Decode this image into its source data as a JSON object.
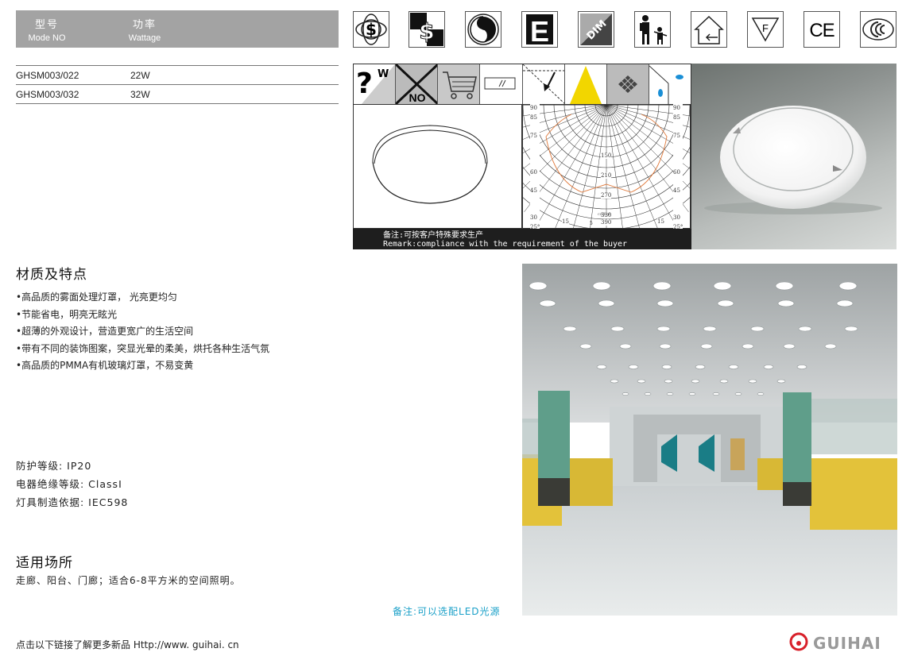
{
  "spec": {
    "header": {
      "model_cn": "型号",
      "model_en": "Mode NO",
      "watt_cn": "功率",
      "watt_en": "Wattage"
    },
    "rows": [
      {
        "model": "GHSM003/022",
        "watt": "22W"
      },
      {
        "model": "GHSM003/032",
        "watt": "32W"
      }
    ]
  },
  "cert_icons": [
    "energy-saving-icon",
    "cost-saving-icon",
    "recycle-icon",
    "e-mark-icon",
    "dim-icon",
    "child-safety-icon",
    "indoor-use-icon",
    "f-mark-icon",
    "ce-mark-icon",
    "ccc-mark-icon"
  ],
  "cert_labels": {
    "e": "E",
    "dim": "DIM",
    "f": "F",
    "ce": "CE"
  },
  "strip_labels": {
    "question": "?",
    "w": "W",
    "no": "NO"
  },
  "polar": {
    "left_ticks": [
      "90",
      "85",
      "75",
      "60",
      "45",
      "30",
      "25°"
    ],
    "right_ticks": [
      "90",
      "85",
      "75",
      "60",
      "45",
      "30",
      "25°"
    ],
    "center_ticks": [
      "150",
      "210",
      "270",
      "330",
      "390"
    ],
    "bottom_ticks": [
      "15",
      "5"
    ],
    "caption": "cd/klm"
  },
  "remark": {
    "cn": "备注:可按客户特殊要求生产",
    "en": "Remark:compliance with the requirement of the buyer"
  },
  "features": {
    "title": "材质及特点",
    "items": [
      "•高品质的雾面处理灯罩， 光亮更均匀",
      "•节能省电，明亮无眩光",
      "•超薄的外观设计，营造更宽广的生活空间",
      "•带有不同的装饰图案，突显光晕的柔美，烘托各种生活气氛",
      "•高品质的PMMA有机玻璃灯罩，不易变黄"
    ]
  },
  "params": [
    "防护等级: IP20",
    "电器绝缘等级: ClassI",
    "灯具制造依据: IEC598"
  ],
  "usage": {
    "title": "适用场所",
    "text": "走廊、阳台、门廊；适合6-8平方米的空间照明。"
  },
  "led_note": "备注:可以选配LED光源",
  "footer": "点击以下链接了解更多新品 Http://www. guihai. cn",
  "brand": "GUIHAI",
  "colors": {
    "header_gray": "#a3a3a3",
    "accent_blue": "#1aa0c8",
    "brand_red": "#d8202a",
    "brand_gray": "#9a9a9a",
    "polar_curve": "#e07a3c"
  }
}
